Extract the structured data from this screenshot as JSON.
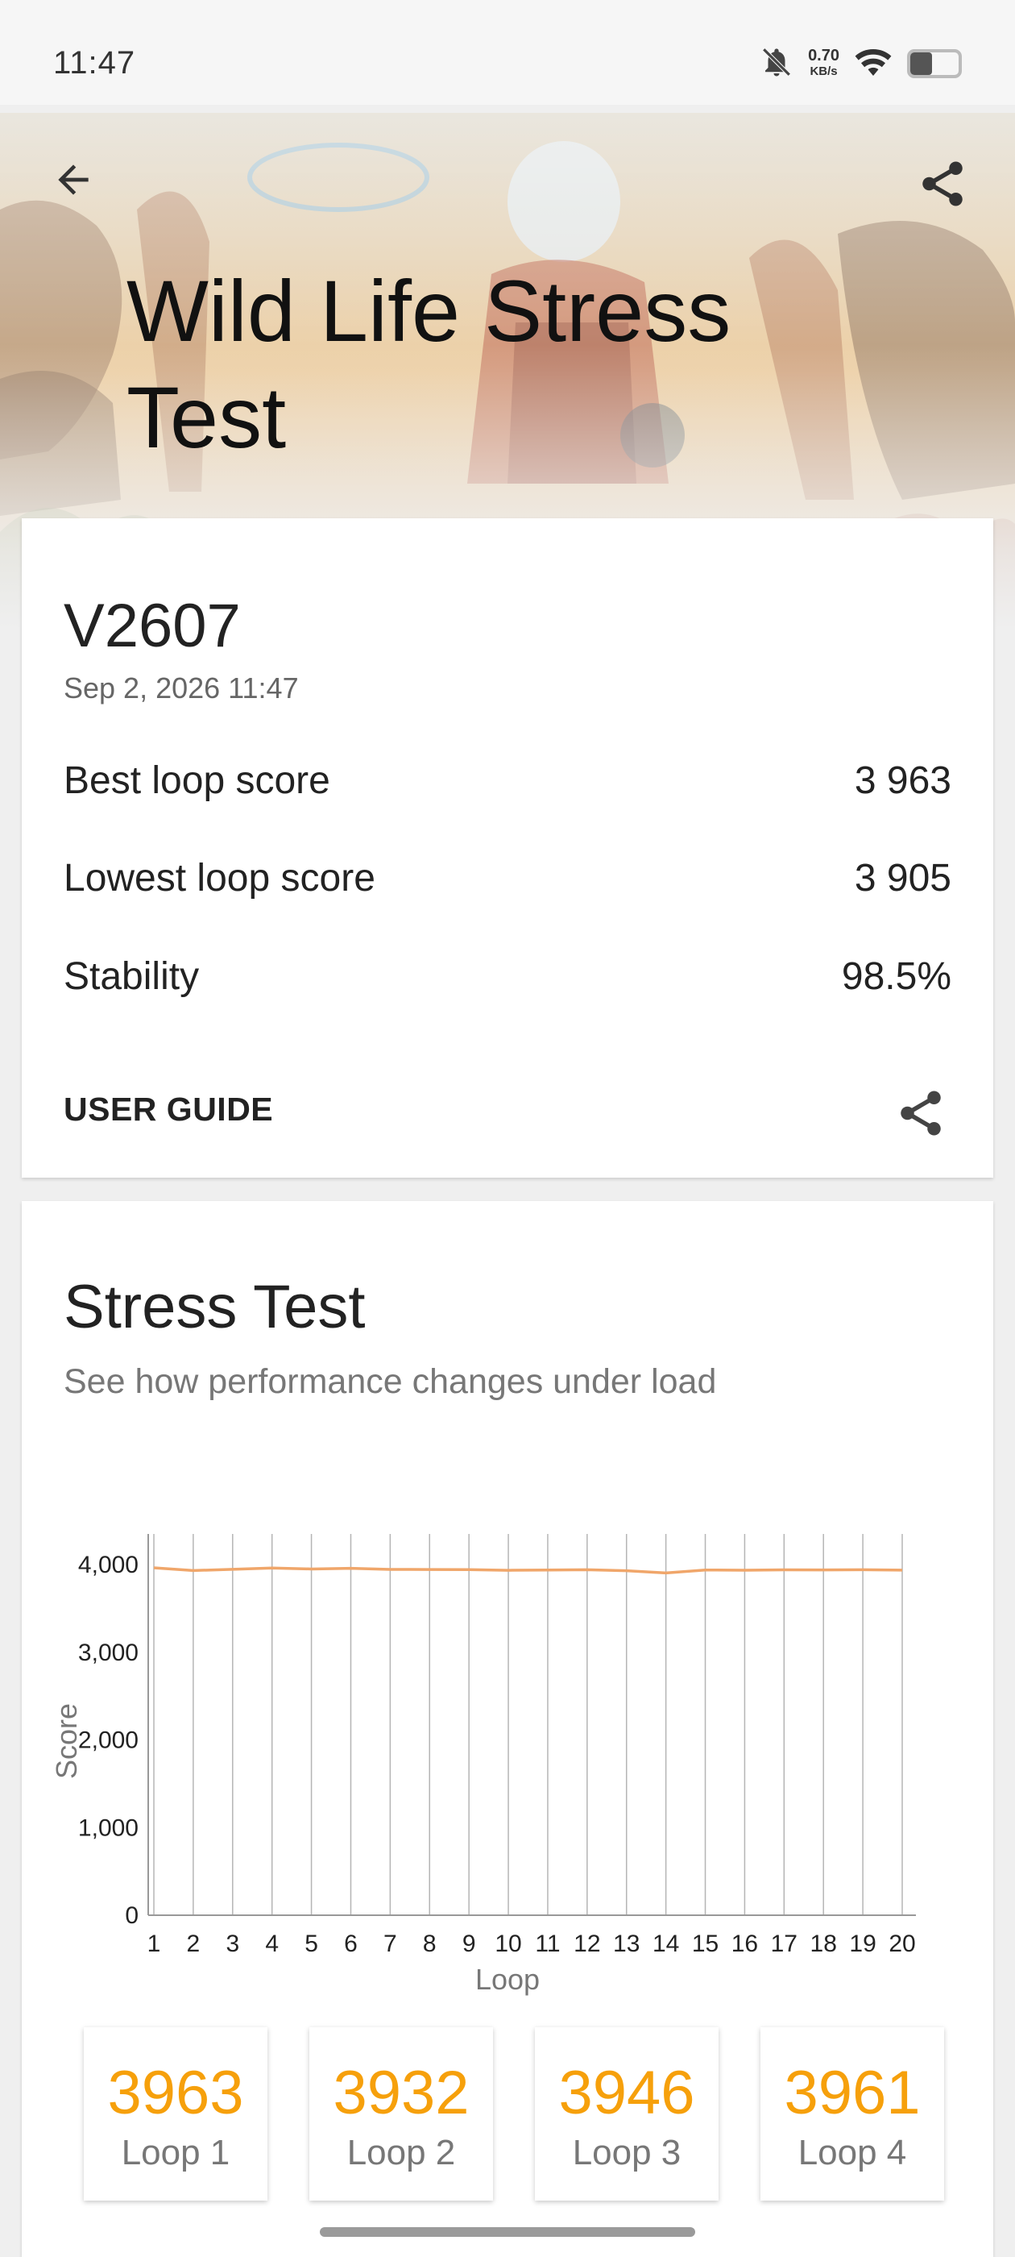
{
  "status_bar": {
    "time": "11:47",
    "net_speed_value": "0.70",
    "net_speed_unit": "KB/s",
    "icons": [
      "bell-muted-icon",
      "wifi-icon",
      "battery-icon"
    ],
    "battery_level": 0.45
  },
  "header": {
    "title": "Wild Life Stress Test",
    "back_icon": "arrow-left-icon",
    "share_icon": "share-icon"
  },
  "result": {
    "device": "V2607",
    "date": "Sep 2, 2026 11:47",
    "stats": [
      {
        "label": "Best loop score",
        "value": "3 963"
      },
      {
        "label": "Lowest loop score",
        "value": "3 905"
      },
      {
        "label": "Stability",
        "value": "98.5%"
      }
    ],
    "user_guide": "USER GUIDE"
  },
  "stress": {
    "title": "Stress Test",
    "subtitle": "See how performance changes under load",
    "loops": [
      {
        "score": "3963",
        "label": "Loop 1"
      },
      {
        "score": "3932",
        "label": "Loop 2"
      },
      {
        "score": "3946",
        "label": "Loop 3"
      },
      {
        "score": "3961",
        "label": "Loop 4"
      }
    ]
  },
  "colors": {
    "accent": "#f6a00b",
    "line": "#f0a66a",
    "grid": "#b5b5b5"
  },
  "chart_data": {
    "type": "line",
    "xlabel": "Loop",
    "ylabel": "Score",
    "ylim": [
      0,
      4000
    ],
    "yticks": [
      "0",
      "1,000",
      "2,000",
      "3,000",
      "4,000"
    ],
    "x": [
      1,
      2,
      3,
      4,
      5,
      6,
      7,
      8,
      9,
      10,
      11,
      12,
      13,
      14,
      15,
      16,
      17,
      18,
      19,
      20
    ],
    "series": [
      {
        "values": [
          3963,
          3932,
          3946,
          3961,
          3950,
          3958,
          3945,
          3944,
          3942,
          3935,
          3938,
          3941,
          3930,
          3905,
          3938,
          3936,
          3940,
          3939,
          3941,
          3937
        ]
      }
    ],
    "grid": "vertical"
  }
}
